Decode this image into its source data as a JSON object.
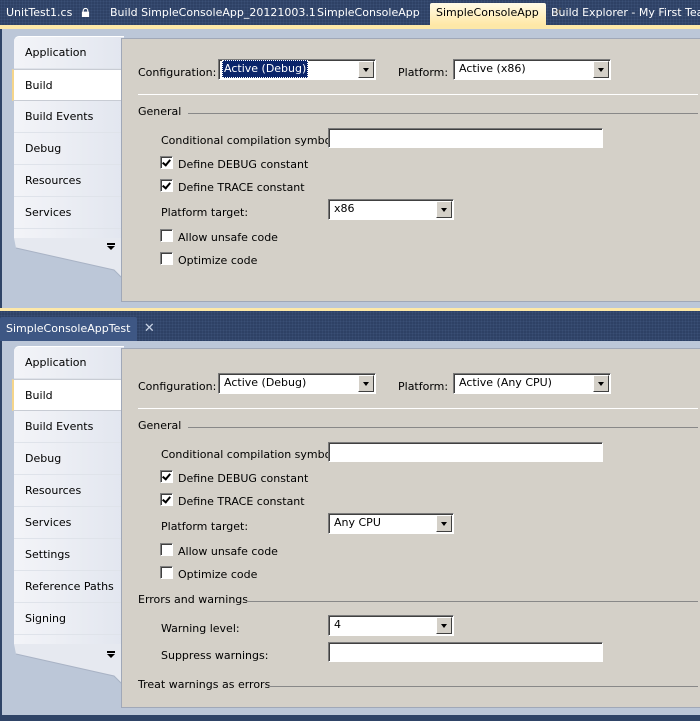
{
  "top_tabs": [
    {
      "label": "UnitTest1.cs",
      "icon": "lock-icon",
      "state": "normal"
    },
    {
      "label": "Build SimpleConsoleApp_20121003.1",
      "state": "normal"
    },
    {
      "label": "SimpleConsoleApp",
      "state": "normal"
    },
    {
      "label": "SimpleConsoleApp",
      "state": "active",
      "close": "✕"
    },
    {
      "label": "Build Explorer - My First Team P",
      "state": "normal"
    }
  ],
  "bottom_tabs": [
    {
      "label": "SimpleConsoleAppTest",
      "state": "selected",
      "close": "✕"
    }
  ],
  "panes": [
    {
      "nav": [
        "Application",
        "Build",
        "Build Events",
        "Debug",
        "Resources",
        "Services"
      ],
      "nav_selected": 1,
      "configuration_label": "Configuration:",
      "configuration_value": "Active (Debug)",
      "configuration_focused": true,
      "platform_label": "Platform:",
      "platform_value": "Active (x86)",
      "general_title": "General",
      "symbols_label": "Conditional compilation symbols:",
      "symbols_value": "",
      "define_debug_label": "Define DEBUG constant",
      "define_debug": true,
      "define_trace_label": "Define TRACE constant",
      "define_trace": true,
      "platform_target_label": "Platform target:",
      "platform_target_value": "x86",
      "unsafe_label": "Allow unsafe code",
      "unsafe": false,
      "optimize_label": "Optimize code",
      "optimize": false
    },
    {
      "nav": [
        "Application",
        "Build",
        "Build Events",
        "Debug",
        "Resources",
        "Services",
        "Settings",
        "Reference Paths",
        "Signing"
      ],
      "nav_selected": 1,
      "configuration_label": "Configuration:",
      "configuration_value": "Active (Debug)",
      "configuration_focused": false,
      "platform_label": "Platform:",
      "platform_value": "Active (Any CPU)",
      "general_title": "General",
      "symbols_label": "Conditional compilation symbols:",
      "symbols_value": "",
      "define_debug_label": "Define DEBUG constant",
      "define_debug": true,
      "define_trace_label": "Define TRACE constant",
      "define_trace": true,
      "platform_target_label": "Platform target:",
      "platform_target_value": "Any CPU",
      "unsafe_label": "Allow unsafe code",
      "unsafe": false,
      "optimize_label": "Optimize code",
      "optimize": false,
      "errors_title": "Errors and warnings",
      "warning_level_label": "Warning level:",
      "warning_level_value": "4",
      "suppress_label": "Suppress warnings:",
      "suppress_value": "",
      "treat_title": "Treat warnings as errors"
    }
  ],
  "colors": {
    "tabstrip_bg": "#2e4165",
    "active_tab": "#ffe8a6",
    "gold_bar": "#fde8a8",
    "pane_bg": "#bcc7d8",
    "content_bg": "#d4d0c8",
    "selection": "#0a246a"
  }
}
